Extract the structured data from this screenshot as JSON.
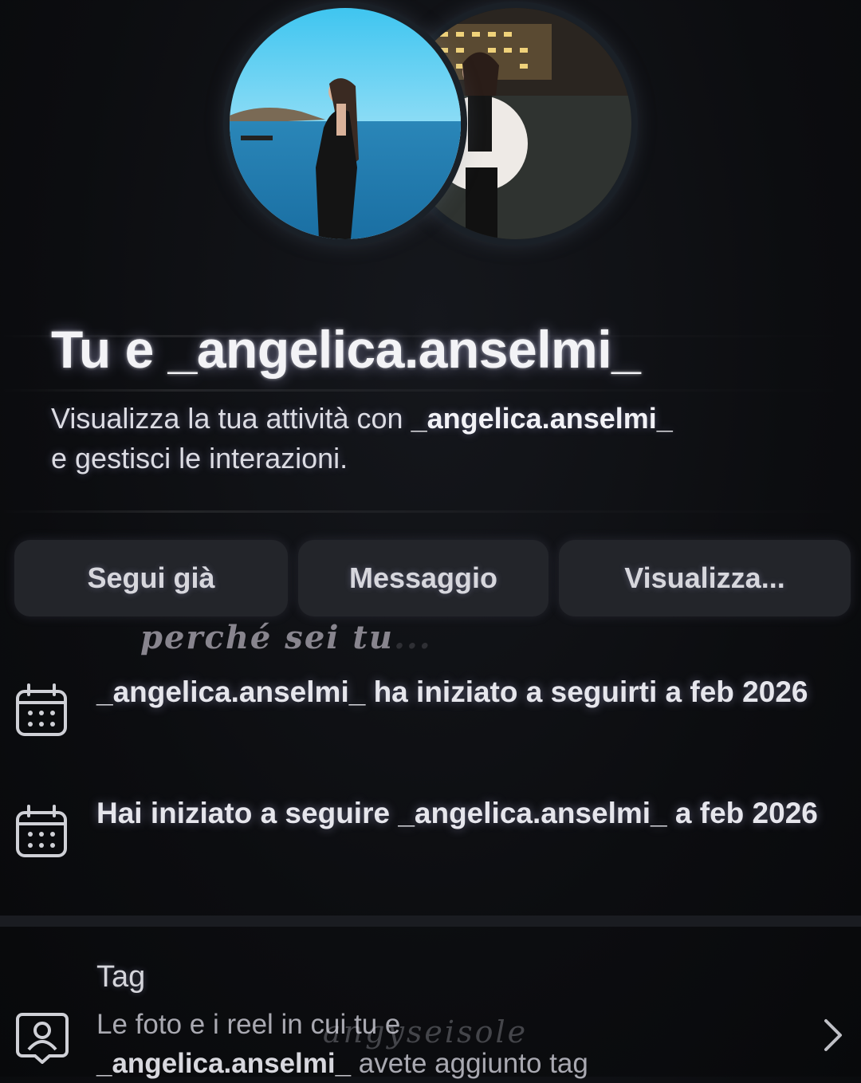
{
  "header": {
    "title": "Tu e _angelica.anselmi_",
    "subtitle_prefix": "Visualizza la tua attività con ",
    "subtitle_username": "_angelica.anselmi_",
    "subtitle_suffix": "e gestisci le interazioni."
  },
  "avatars": [
    {
      "name": "profile-photo-own",
      "scene": "sea at daytime"
    },
    {
      "name": "profile-photo-angelica",
      "scene": "night scene"
    }
  ],
  "buttons": {
    "follow": "Segui già",
    "message": "Messaggio",
    "view": "Visualizza..."
  },
  "overlay": {
    "script_text": "perché sei tu",
    "script_faded": "...",
    "watermark": "angyseisole"
  },
  "activity": [
    {
      "icon": "calendar-icon",
      "text": "_angelica.anselmi_ ha iniziato a seguirti a feb 2026"
    },
    {
      "icon": "calendar-icon",
      "text": "Hai iniziato a seguire _angelica.anselmi_ a feb 2026"
    }
  ],
  "tag_section": {
    "title": "Tag",
    "desc_prefix": "Le foto e i reel in cui tu e",
    "desc_username": "_angelica.anselmi_",
    "desc_suffix": " avete aggiunto tag",
    "icon": "tag-person-icon",
    "chevron": "chevron-right-icon"
  },
  "colors": {
    "background": "#0c0d10",
    "button_bg": "#23252a",
    "text_primary": "#f3f3f6",
    "text_secondary": "#a9a9b1"
  }
}
